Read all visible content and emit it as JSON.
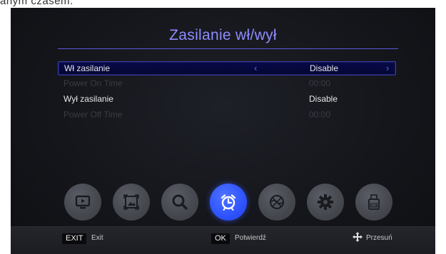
{
  "caption_fragment": "anym czasem.",
  "title": "Zasilanie wł/wył",
  "rows": [
    {
      "label": "Wł zasilanie",
      "value": "Disable"
    },
    {
      "label": "Power On Time",
      "value": "00:00"
    },
    {
      "label": "Wył zasilanie",
      "value": "Disable"
    },
    {
      "label": "Power Off Time",
      "value": "00:00"
    }
  ],
  "arrows": {
    "left": "‹",
    "right": "›"
  },
  "dock": [
    {
      "icon": "media-player-icon"
    },
    {
      "icon": "picture-icon"
    },
    {
      "icon": "search-icon"
    },
    {
      "icon": "alarm-clock-icon",
      "active": true
    },
    {
      "icon": "internet-ball-icon"
    },
    {
      "icon": "settings-gear-icon"
    },
    {
      "icon": "usb-icon"
    }
  ],
  "footer": {
    "exit_key": "EXIT",
    "exit_label": "Exit",
    "ok_key": "OK",
    "ok_label": "Potwierdź",
    "move_label": "Przesuń"
  },
  "colors": {
    "accent": "#2e53ff",
    "title": "#8f8cff"
  }
}
